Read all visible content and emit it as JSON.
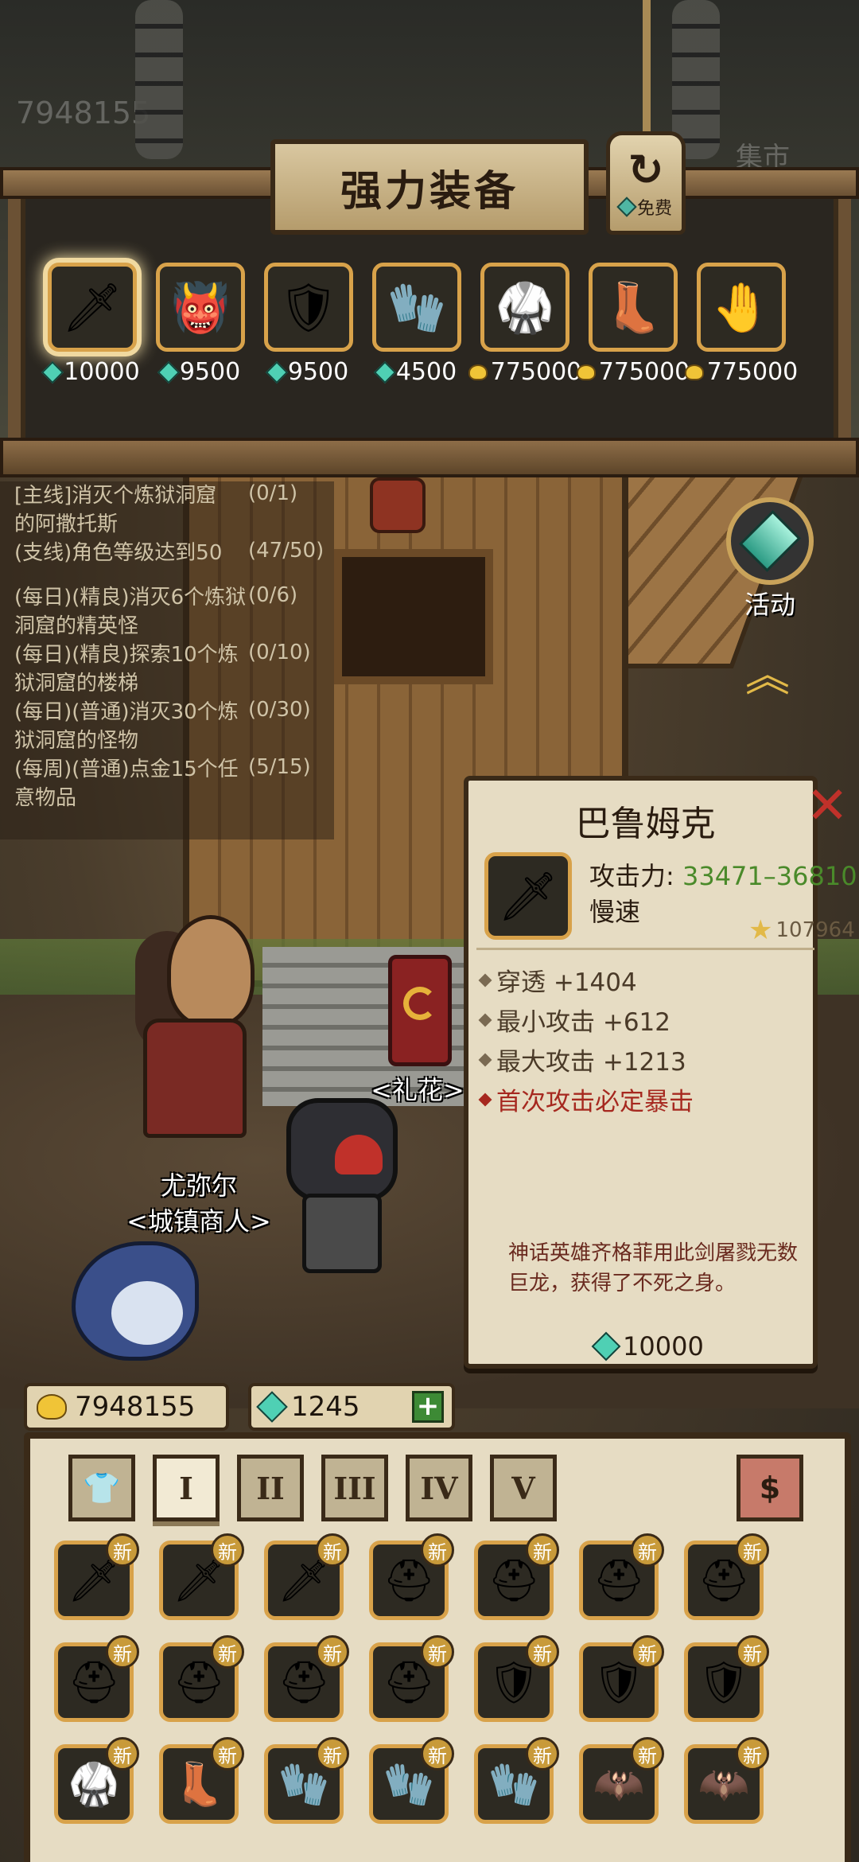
{
  "hud_ghost": {
    "gold": "7948155",
    "market": "集市"
  },
  "shop": {
    "title": "强力装备",
    "refresh_label": "免费",
    "items": [
      {
        "icon": "sword-icon",
        "glyph": "🗡",
        "currency": "gem",
        "price": "10000",
        "selected": true
      },
      {
        "icon": "demon-helmet-icon",
        "glyph": "👹",
        "currency": "gem",
        "price": "9500"
      },
      {
        "icon": "dark-armor-icon",
        "glyph": "🛡",
        "currency": "gem",
        "price": "9500"
      },
      {
        "icon": "fur-gauntlet-icon",
        "glyph": "🧤",
        "currency": "gem",
        "price": "4500"
      },
      {
        "icon": "plate-armor-icon",
        "glyph": "🥋",
        "currency": "gold",
        "price": "775000"
      },
      {
        "icon": "plate-boots-icon",
        "glyph": "👢",
        "currency": "gold",
        "price": "775000"
      },
      {
        "icon": "plate-gauntlet-icon",
        "glyph": "🤚",
        "currency": "gold",
        "price": "775000"
      }
    ]
  },
  "quests": [
    {
      "text1": "[主线]消灭个炼狱洞窟",
      "text2": "的阿撒托斯",
      "progress": "(0/1)"
    },
    {
      "text1": "(支线)角色等级达到50",
      "text2": "",
      "progress": "(47/50)"
    },
    {
      "text1": "(每日)(精良)消灭6个炼狱",
      "text2": "洞窟的精英怪",
      "progress": "(0/6)"
    },
    {
      "text1": "(每日)(精良)探索10个炼",
      "text2": "狱洞窟的楼梯",
      "progress": "(0/10)"
    },
    {
      "text1": "(每日)(普通)消灭30个炼",
      "text2": "狱洞窟的怪物",
      "progress": "(0/30)"
    },
    {
      "text1": "(每周)(普通)点金15个任",
      "text2": "意物品",
      "progress": "(5/15)"
    }
  ],
  "activity": {
    "label": "活动"
  },
  "npcs": {
    "gift": "<礼花>",
    "merchant_name": "尤弥尔",
    "merchant_title": "<城镇商人>"
  },
  "detail": {
    "title": "巴鲁姆克",
    "attack_label": "攻击力: ",
    "attack_value": "33471–36810",
    "speed": "慢速",
    "score": "107964",
    "stats": [
      {
        "text": "穿透 +1404",
        "special": false
      },
      {
        "text": "最小攻击 +612",
        "special": false
      },
      {
        "text": "最大攻击 +1213",
        "special": false
      },
      {
        "text": "首次攻击必定暴击",
        "special": true
      }
    ],
    "lore": "神话英雄齐格菲用此剑屠戮无数巨龙，获得了不死之身。",
    "price": "10000"
  },
  "currency": {
    "gold": "7948155",
    "gems": "1245"
  },
  "inventory": {
    "tabs": [
      {
        "label": "👕",
        "name": "tab-all"
      },
      {
        "label": "I",
        "name": "tab-tier-1"
      },
      {
        "label": "II",
        "name": "tab-tier-2"
      },
      {
        "label": "III",
        "name": "tab-tier-3"
      },
      {
        "label": "IV",
        "name": "tab-tier-4"
      },
      {
        "label": "V",
        "name": "tab-tier-5"
      }
    ],
    "active_tab": 1,
    "new_label": "新",
    "items": [
      {
        "icon": "curved-dagger-icon",
        "glyph": "🗡"
      },
      {
        "icon": "curved-dagger-icon",
        "glyph": "🗡"
      },
      {
        "icon": "curved-dagger-icon",
        "glyph": "🗡"
      },
      {
        "icon": "unknown-helmet-icon",
        "glyph": "⛑"
      },
      {
        "icon": "unknown-helmet-icon",
        "glyph": "⛑"
      },
      {
        "icon": "unknown-helmet-icon",
        "glyph": "⛑"
      },
      {
        "icon": "unknown-helmet-icon",
        "glyph": "⛑"
      },
      {
        "icon": "unknown-helmet-icon",
        "glyph": "⛑"
      },
      {
        "icon": "unknown-helmet-icon",
        "glyph": "⛑"
      },
      {
        "icon": "unknown-helmet-icon",
        "glyph": "⛑"
      },
      {
        "icon": "unknown-helmet-icon",
        "glyph": "⛑"
      },
      {
        "icon": "dark-armor-icon",
        "glyph": "🛡"
      },
      {
        "icon": "dark-armor-icon",
        "glyph": "🛡"
      },
      {
        "icon": "dark-armor-icon",
        "glyph": "🛡"
      },
      {
        "icon": "red-chest-armor-icon",
        "glyph": "🥋"
      },
      {
        "icon": "dark-boots-icon",
        "glyph": "👢"
      },
      {
        "icon": "red-glove-icon",
        "glyph": "🧤"
      },
      {
        "icon": "red-glove-icon",
        "glyph": "🧤"
      },
      {
        "icon": "red-glove-icon",
        "glyph": "🧤"
      },
      {
        "icon": "bat-amulet-icon",
        "glyph": "🦇"
      },
      {
        "icon": "bat-amulet-icon",
        "glyph": "🦇"
      }
    ]
  }
}
